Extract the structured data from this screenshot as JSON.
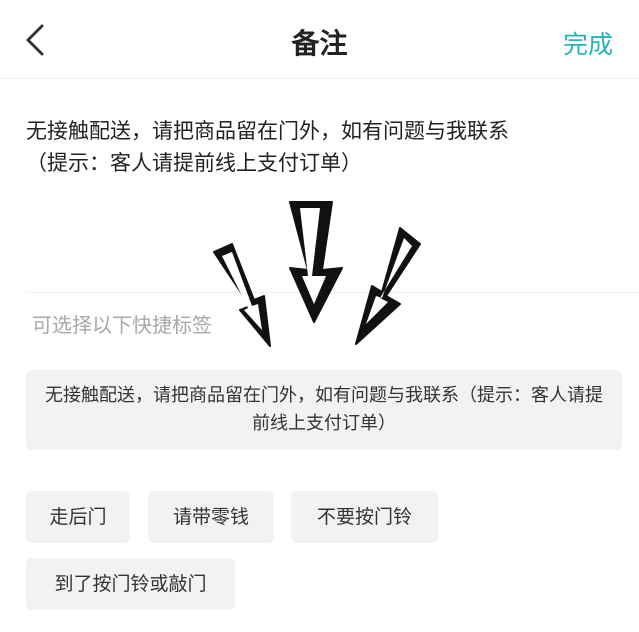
{
  "header": {
    "title": "备注",
    "done_label": "完成"
  },
  "note": {
    "text": "无接触配送，请把商品留在门外，如有问题与我联系\n（提示：客人请提前线上支付订单）"
  },
  "quick_tags": {
    "hint": "可选择以下快捷标签",
    "suggestion": "无接触配送，请把商品留在门外，如有问题与我联系（提示：客人请提前线上支付订单）",
    "tags": [
      "走后门",
      "请带零钱",
      "不要按门铃",
      "到了按门铃或敲门"
    ]
  },
  "decorations": {
    "arrows": [
      "arrow-down-left-icon",
      "arrow-down-icon",
      "arrow-down-right-icon"
    ]
  }
}
